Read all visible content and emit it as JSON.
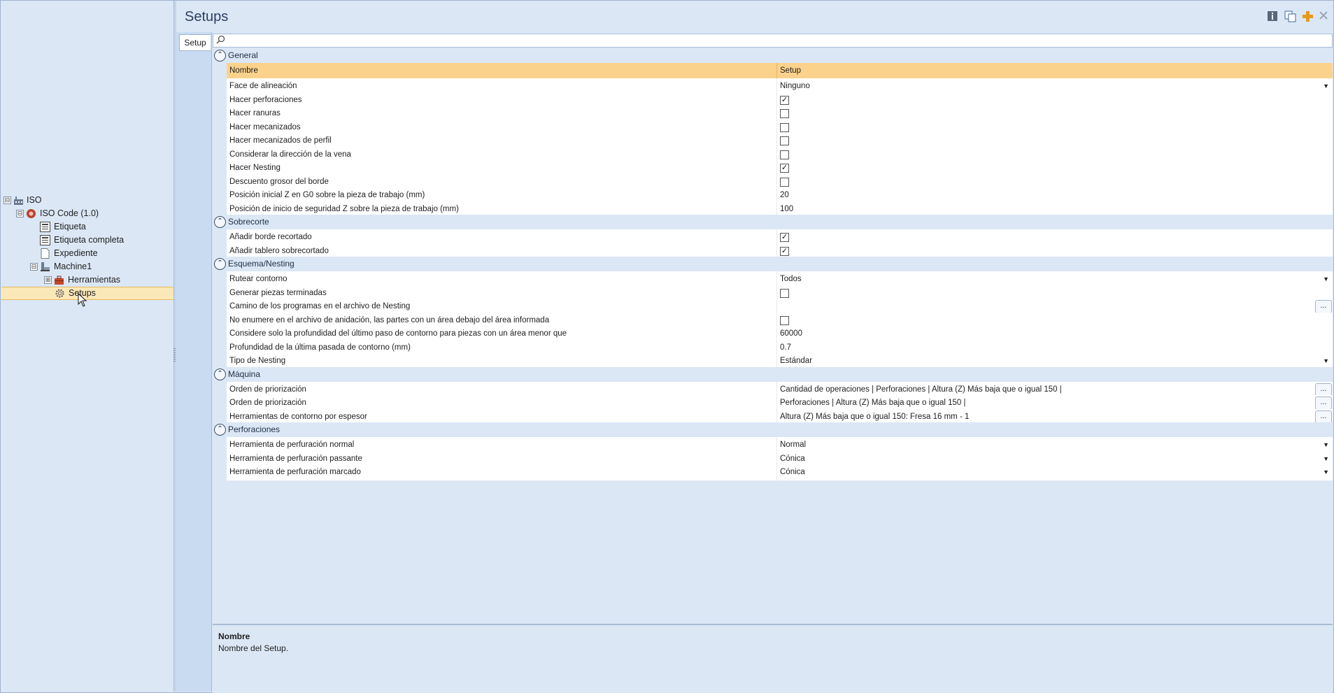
{
  "tree": {
    "nodes": [
      {
        "label": "ISO",
        "icon": "factory-icon",
        "expander": "⊟"
      },
      {
        "label": "ISO Code (1.0)",
        "icon": "iso-code-icon",
        "expander": "⊟"
      },
      {
        "label": "Etiqueta",
        "icon": "label-icon",
        "expander": ""
      },
      {
        "label": "Etiqueta completa",
        "icon": "label-icon",
        "expander": ""
      },
      {
        "label": "Expediente",
        "icon": "document-icon",
        "expander": ""
      },
      {
        "label": "Machine1",
        "icon": "machine-icon",
        "expander": "⊟"
      },
      {
        "label": "Herramientas",
        "icon": "toolbox-icon",
        "expander": "⊞"
      },
      {
        "label": "Setups",
        "icon": "gear-icon",
        "expander": ""
      }
    ]
  },
  "header": {
    "title": "Setups",
    "toolbar_icons": [
      "info-icon",
      "copy-icon",
      "add-icon",
      "close-icon"
    ],
    "tab_label": "Setup",
    "search_icon": "search-icon"
  },
  "grid": {
    "header": {
      "name": "Nombre",
      "value": "Setup"
    },
    "categories": [
      {
        "label": "General",
        "rows": [
          {
            "name": "Face de alineación",
            "type": "dropdown",
            "value": "Ninguno"
          },
          {
            "name": "Hacer perforaciones",
            "type": "check",
            "checked": true
          },
          {
            "name": "Hacer ranuras",
            "type": "check",
            "checked": false
          },
          {
            "name": "Hacer mecanizados",
            "type": "check",
            "checked": false
          },
          {
            "name": "Hacer mecanizados de perfil",
            "type": "check",
            "checked": false
          },
          {
            "name": "Considerar la dirección de la vena",
            "type": "check",
            "checked": false
          },
          {
            "name": "Hacer Nesting",
            "type": "check",
            "checked": true
          },
          {
            "name": "Descuento grosor del borde",
            "type": "check",
            "checked": false
          },
          {
            "name": "Posición inicial Z en G0 sobre la pieza de trabajo (mm)",
            "type": "text",
            "value": "20"
          },
          {
            "name": "Posición de inicio de seguridad Z sobre la pieza de trabajo (mm)",
            "type": "text",
            "value": "100"
          }
        ]
      },
      {
        "label": "Sobrecorte",
        "rows": [
          {
            "name": "Añadir borde recortado",
            "type": "check",
            "checked": true
          },
          {
            "name": "Añadir tablero sobrecortado",
            "type": "check",
            "checked": true
          }
        ]
      },
      {
        "label": "Esquema/Nesting",
        "rows": [
          {
            "name": "Rutear contorno",
            "type": "dropdown",
            "value": "Todos"
          },
          {
            "name": "Generar piezas terminadas",
            "type": "check",
            "checked": false
          },
          {
            "name": "Camino de los programas en el archivo de Nesting",
            "type": "ellipsis",
            "value": ""
          },
          {
            "name": "No enumere en el archivo de anidación, las partes con un área debajo del área informada",
            "type": "check",
            "checked": false
          },
          {
            "name": "Considere solo la profundidad del último paso de contorno para piezas con un área menor que",
            "type": "text",
            "value": "60000"
          },
          {
            "name": "Profundidad de la última pasada de contorno (mm)",
            "type": "text",
            "value": "0.7"
          },
          {
            "name": "Tipo de Nesting",
            "type": "dropdown",
            "value": "Estándar"
          }
        ]
      },
      {
        "label": "Máquina",
        "rows": [
          {
            "name": "Orden de priorización",
            "type": "ellipsis",
            "value": "Cantidad de operaciones | Perforaciones | Altura (Z) Más baja que o igual 150 |"
          },
          {
            "name": "Orden de priorización",
            "type": "ellipsis",
            "value": "Perforaciones | Altura (Z) Más baja que o igual 150 |"
          },
          {
            "name": "Herramientas de contorno por espesor",
            "type": "ellipsis",
            "value": "Altura (Z) Más baja que o igual 150: Fresa 16 mm - 1"
          }
        ]
      },
      {
        "label": "Perforaciones",
        "rows": [
          {
            "name": "Herramienta de perfuración normal",
            "type": "dropdown",
            "value": "Normal"
          },
          {
            "name": "Herramienta de perfuración passante",
            "type": "dropdown",
            "value": "Cónica"
          },
          {
            "name": "Herramienta de perfuración marcado",
            "type": "dropdown",
            "value": "Cónica"
          }
        ]
      }
    ]
  },
  "description": {
    "title": "Nombre",
    "text": "Nombre del Setup."
  },
  "glyphs": {
    "collapse": "⌃",
    "dropdown": "▼",
    "ellipsis": "...",
    "check": "✓"
  }
}
